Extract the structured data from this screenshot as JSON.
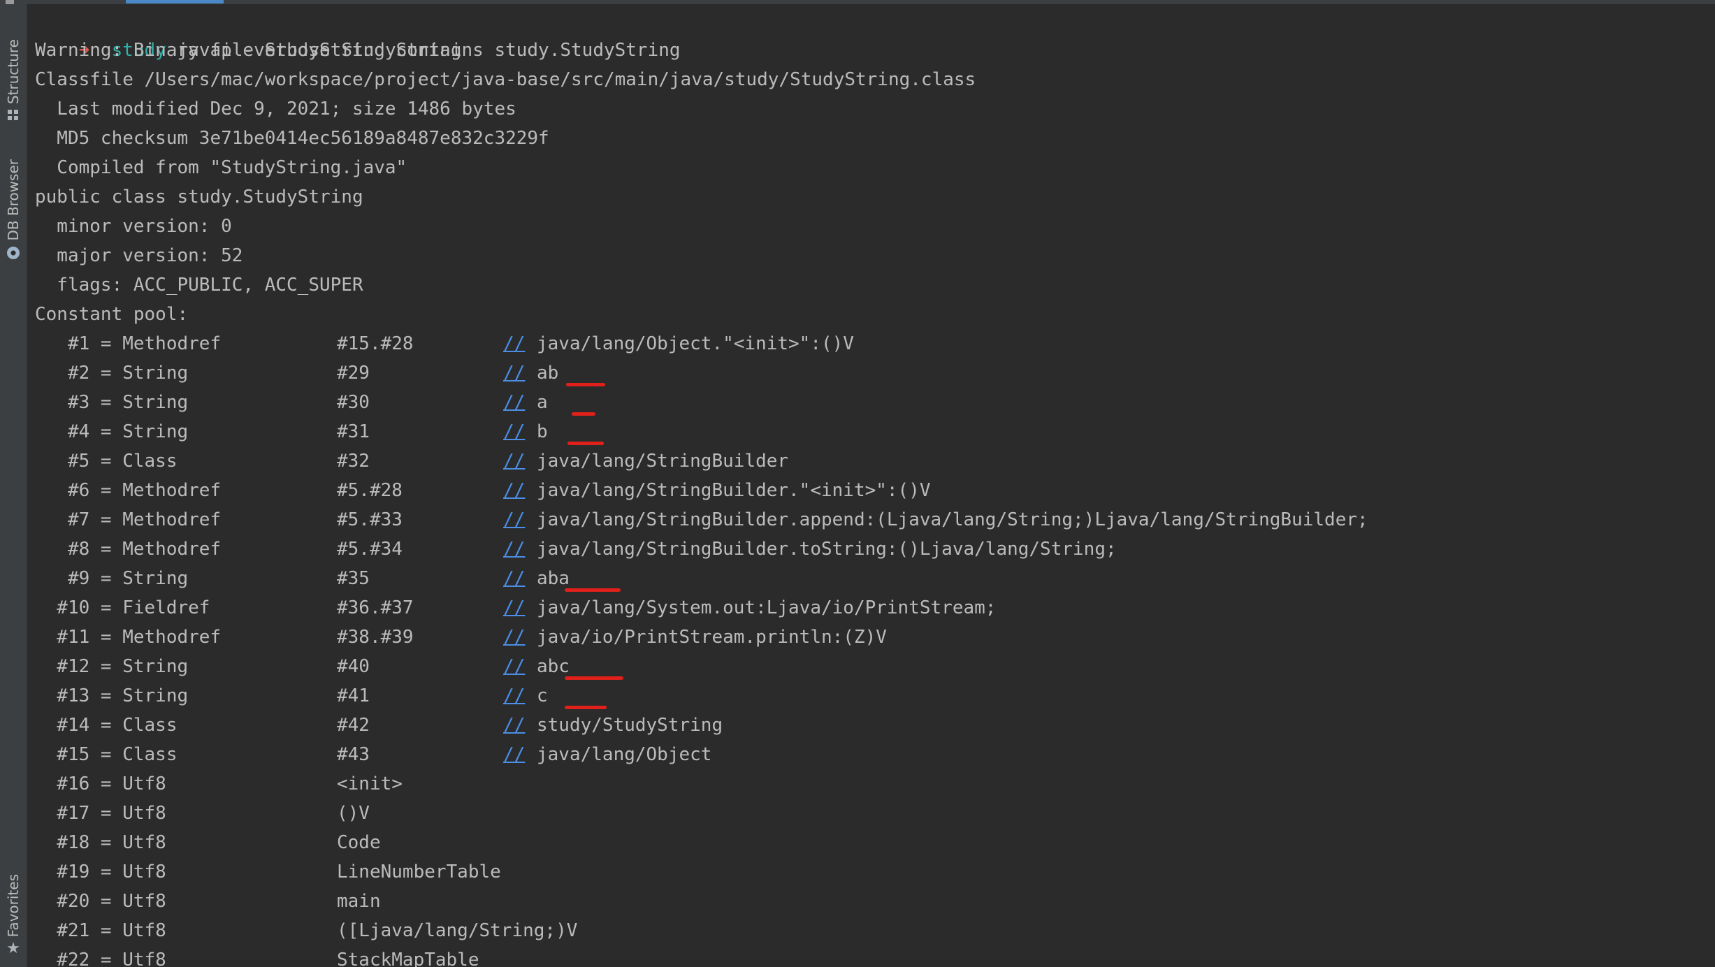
{
  "sidebar": {
    "structure_label": "Structure",
    "db_label": "DB Browser",
    "favorites_label": "Favorites"
  },
  "terminal": {
    "prompt": {
      "arrow": "➜",
      "dir": "study",
      "command": "javap -verbose StudyString"
    },
    "header_lines": [
      "Warning: Binary file StudyString contains study.StudyString",
      "Classfile /Users/mac/workspace/project/java-base/src/main/java/study/StudyString.class",
      "  Last modified Dec 9, 2021; size 1486 bytes",
      "  MD5 checksum 3e71be0414ec56189a8487e832c3229f",
      "  Compiled from \"StudyString.java\"",
      "public class study.StudyString",
      "  minor version: 0",
      "  major version: 52",
      "  flags: ACC_PUBLIC, ACC_SUPER",
      "Constant pool:"
    ],
    "constant_pool": [
      {
        "idx": "   #1 = Methodref",
        "ref": "#15.#28",
        "comment": "//",
        "value": "java/lang/Object.\"<init>\":()V"
      },
      {
        "idx": "   #2 = String",
        "ref": "#29",
        "comment": "//",
        "value": "ab"
      },
      {
        "idx": "   #3 = String",
        "ref": "#30",
        "comment": "//",
        "value": "a"
      },
      {
        "idx": "   #4 = String",
        "ref": "#31",
        "comment": "//",
        "value": "b"
      },
      {
        "idx": "   #5 = Class",
        "ref": "#32",
        "comment": "//",
        "value": "java/lang/StringBuilder"
      },
      {
        "idx": "   #6 = Methodref",
        "ref": "#5.#28",
        "comment": "//",
        "value": "java/lang/StringBuilder.\"<init>\":()V"
      },
      {
        "idx": "   #7 = Methodref",
        "ref": "#5.#33",
        "comment": "//",
        "value": "java/lang/StringBuilder.append:(Ljava/lang/String;)Ljava/lang/StringBuilder;"
      },
      {
        "idx": "   #8 = Methodref",
        "ref": "#5.#34",
        "comment": "//",
        "value": "java/lang/StringBuilder.toString:()Ljava/lang/String;"
      },
      {
        "idx": "   #9 = String",
        "ref": "#35",
        "comment": "//",
        "value": "aba"
      },
      {
        "idx": "  #10 = Fieldref",
        "ref": "#36.#37",
        "comment": "//",
        "value": "java/lang/System.out:Ljava/io/PrintStream;"
      },
      {
        "idx": "  #11 = Methodref",
        "ref": "#38.#39",
        "comment": "//",
        "value": "java/io/PrintStream.println:(Z)V"
      },
      {
        "idx": "  #12 = String",
        "ref": "#40",
        "comment": "//",
        "value": "abc"
      },
      {
        "idx": "  #13 = String",
        "ref": "#41",
        "comment": "//",
        "value": "c"
      },
      {
        "idx": "  #14 = Class",
        "ref": "#42",
        "comment": "//",
        "value": "study/StudyString"
      },
      {
        "idx": "  #15 = Class",
        "ref": "#43",
        "comment": "//",
        "value": "java/lang/Object"
      },
      {
        "idx": "  #16 = Utf8",
        "ref": "<init>",
        "comment": "",
        "value": ""
      },
      {
        "idx": "  #17 = Utf8",
        "ref": "()V",
        "comment": "",
        "value": ""
      },
      {
        "idx": "  #18 = Utf8",
        "ref": "Code",
        "comment": "",
        "value": ""
      },
      {
        "idx": "  #19 = Utf8",
        "ref": "LineNumberTable",
        "comment": "",
        "value": ""
      },
      {
        "idx": "  #20 = Utf8",
        "ref": "main",
        "comment": "",
        "value": ""
      },
      {
        "idx": "  #21 = Utf8",
        "ref": "([Ljava/lang/String;)V",
        "comment": "",
        "value": ""
      },
      {
        "idx": "  #22 = Utf8",
        "ref": "StackMapTable",
        "comment": "",
        "value": ""
      }
    ]
  },
  "colors": {
    "background": "#2b2b2b",
    "text": "#bbbbbb",
    "prompt_arrow": "#e05a4f",
    "prompt_dir": "#2fb0a8",
    "comment_link": "#4b8fe6",
    "annotation_mark": "#e0201a"
  }
}
